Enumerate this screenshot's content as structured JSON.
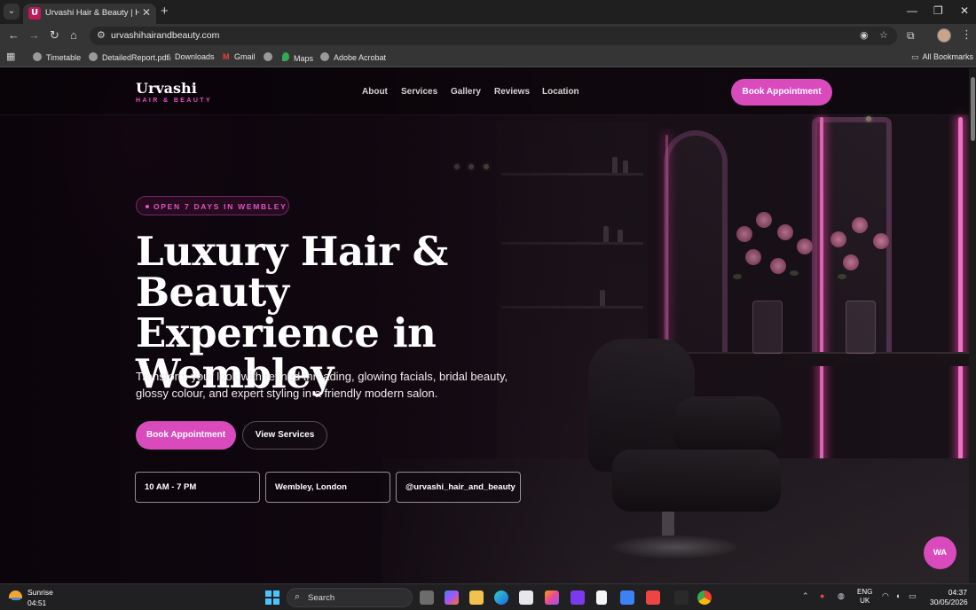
{
  "browser": {
    "tab_title": "Urvashi Hair & Beauty | Hair Sa",
    "tab_favicon": "U",
    "url": "urvashihairandbeauty.com",
    "bookmarks": [
      "Timetable",
      "DetailedReport.pdf",
      "Downloads",
      "Gmail",
      "",
      "Maps",
      "Adobe Acrobat"
    ],
    "all_bookmarks": "All Bookmarks"
  },
  "site": {
    "brand": "Urvashi",
    "brand_sub": "HAIR & BEAUTY",
    "nav": [
      "About",
      "Services",
      "Gallery",
      "Reviews",
      "Location"
    ],
    "cta": "Book Appointment",
    "accent_color": "#d94bbd"
  },
  "hero": {
    "badge": "OPEN 7 DAYS IN WEMBLEY",
    "title_lines": [
      "Luxury Hair & Beauty",
      "Experience in",
      "Wembley"
    ],
    "subtitle": "Transform your look with refined threading, glowing facials, bridal beauty, glossy colour, and expert styling in a friendly modern salon.",
    "primary_button": "Book Appointment",
    "secondary_button": "View Services",
    "info": [
      "10 AM - 7 PM",
      "Wembley, London",
      "@urvashi_hair_and_beauty"
    ]
  },
  "whatsapp_button": "WA",
  "taskbar": {
    "weather_label": "Sunrise",
    "weather_time": "04:51",
    "search_placeholder": "Search",
    "lang_line1": "ENG",
    "lang_line2": "UK",
    "time": "04:37",
    "date": "30/05/2026"
  }
}
